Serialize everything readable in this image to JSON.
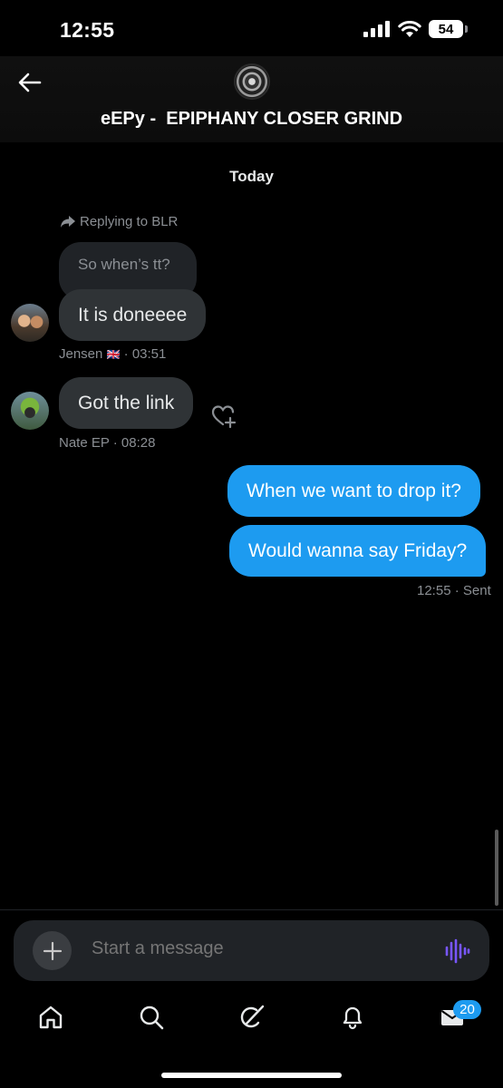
{
  "status_bar": {
    "time": "12:55",
    "battery": "54"
  },
  "header": {
    "title": "eEPy -  EPIPHANY CLOSER GRIND",
    "avatar_icon": "group-avatar"
  },
  "date_separator": "Today",
  "messages": [
    {
      "reply_info": "Replying to BLR",
      "quoted_text": "So when’s tt?",
      "text": "It is doneeee",
      "sender": "Jensen",
      "sender_flag": "🇬🇧",
      "time": "· 03:51"
    },
    {
      "text": "Got the link",
      "sender": "Nate EP",
      "time": "· 08:28"
    },
    {
      "text": "When we want to drop it?"
    },
    {
      "text": "Would wanna say Friday?"
    }
  ],
  "sent_status": {
    "time": "12:55",
    "status": "· Sent"
  },
  "composer": {
    "placeholder": "Start a message"
  },
  "tabbar": {
    "messages_badge": "20"
  },
  "colors": {
    "accent": "#1d9bf0",
    "voice": "#7856ff",
    "bubble_in": "#2f3336"
  }
}
